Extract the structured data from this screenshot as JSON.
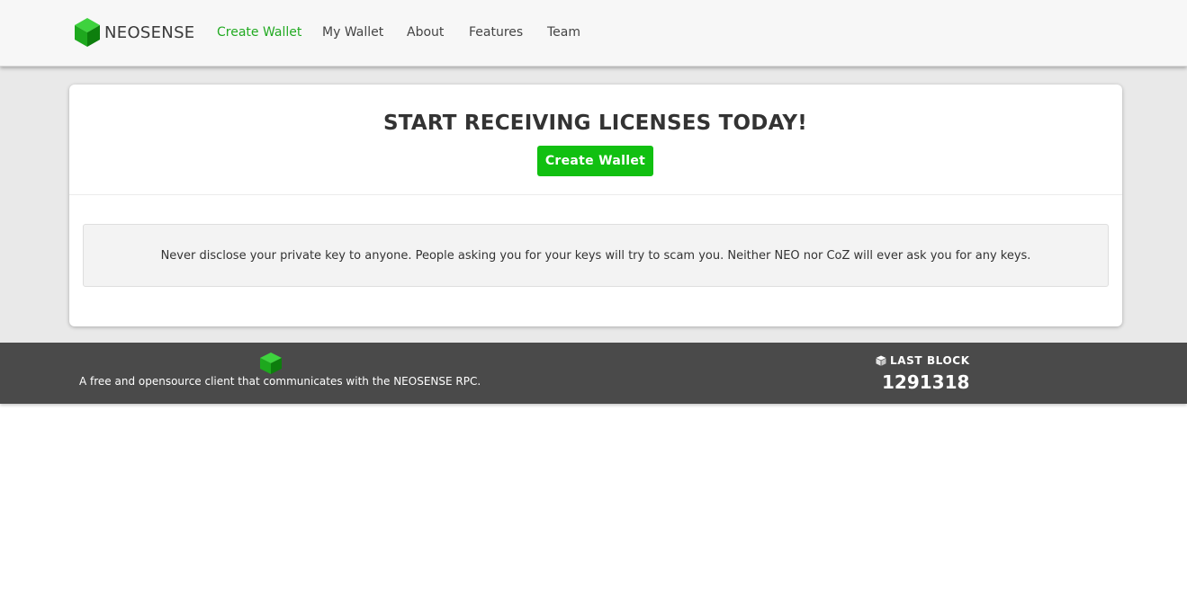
{
  "brand": {
    "name": "NEOSENSE",
    "logo_icon": "neo-cube-icon",
    "color": "#22aa22"
  },
  "nav": {
    "links": [
      {
        "label": "Create Wallet",
        "active": true
      },
      {
        "label": "My Wallet",
        "active": false
      },
      {
        "label": "About",
        "active": false
      },
      {
        "label": "Features",
        "active": false
      },
      {
        "label": "Team",
        "active": false
      }
    ]
  },
  "hero": {
    "title": "START RECEIVING LICENSES TODAY!",
    "cta_label": "Create Wallet",
    "cta_color": "#11c011"
  },
  "warning": {
    "text": "Never disclose your private key to anyone. People asking you for your keys will try to scam you. Neither NEO nor CoZ will ever ask you for any keys."
  },
  "footer": {
    "logo_icon": "neo-cube-icon",
    "description": "A free and opensource client that communicates with the NEOSENSE RPC.",
    "last_block_icon": "cube-icon",
    "last_block_label": "LAST BLOCK",
    "last_block_value": "1291318",
    "background": "#4a4a4a"
  }
}
